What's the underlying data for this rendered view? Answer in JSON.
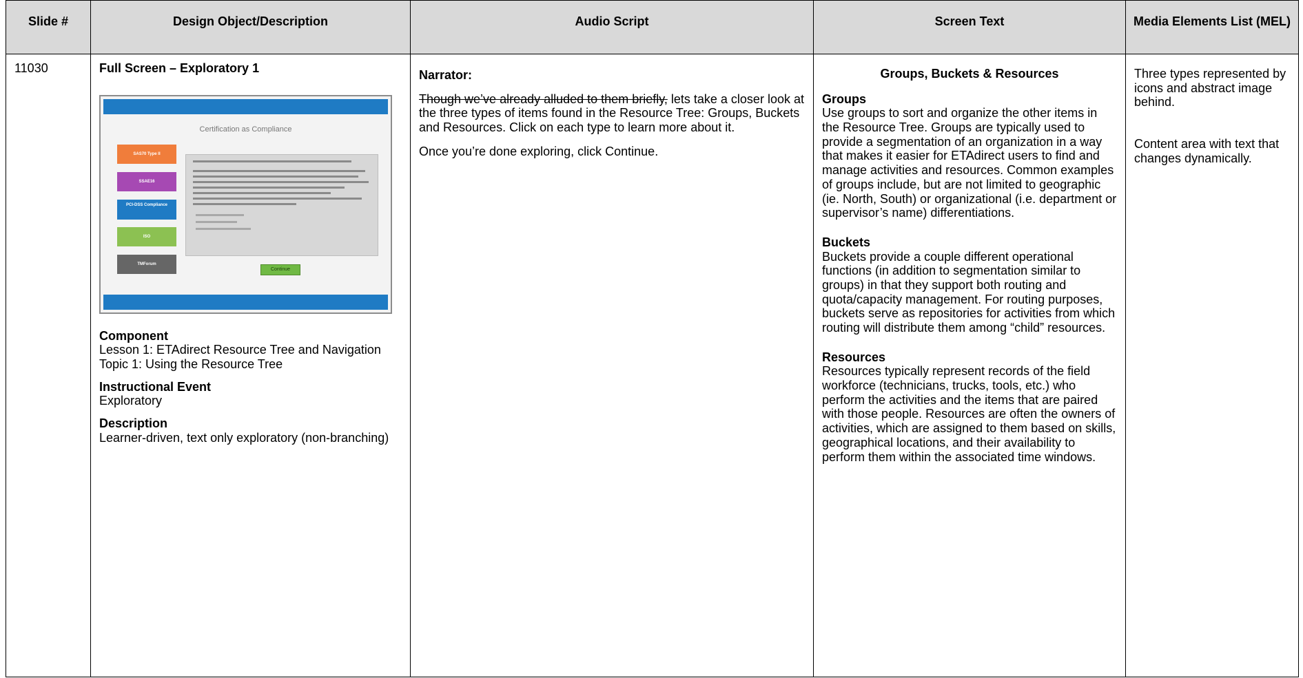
{
  "headers": {
    "slide": "Slide #",
    "design": "Design Object/Description",
    "audio": "Audio Script",
    "screen": "Screen Text",
    "mel": "Media Elements List (MEL)"
  },
  "row": {
    "slide_number": "11030",
    "design": {
      "title": "Full Screen – Exploratory 1",
      "thumbnail": {
        "title": "Certification as Compliance",
        "buttons": [
          {
            "label": "SAS70 Type II",
            "color": "#f07d3b"
          },
          {
            "label": "SSAE16",
            "color": "#a649b3"
          },
          {
            "label": "PCI-DSS Compliance",
            "color": "#1f7bc4"
          },
          {
            "label": "ISO",
            "color": "#8cc152"
          },
          {
            "label": "TMForum",
            "color": "#666666"
          }
        ],
        "continue_label": "Continue"
      },
      "component_heading": "Component",
      "component_line1": "Lesson 1: ETAdirect Resource Tree and Navigation",
      "component_line2": "Topic 1: Using the Resource Tree",
      "event_heading": "Instructional Event",
      "event_value": "Exploratory",
      "description_heading": "Description",
      "description_value": "Learner-driven, text only exploratory (non-branching)"
    },
    "audio": {
      "speaker": "Narrator:",
      "struck": "Though we’ve already alluded to them briefly,",
      "para1_rest": " lets take a closer look at the three types of items found in the Resource Tree: Groups, Buckets and Resources. Click on each type to learn more about it.",
      "para2": "Once you’re done exploring, click Continue."
    },
    "screen_text": {
      "title": "Groups, Buckets & Resources",
      "groups_heading": "Groups",
      "groups_body": "Use groups to sort and organize the other items in the Resource Tree. Groups are typically used to provide a segmentation of an organization in a way that makes it easier for ETAdirect users to find and manage activities and resources. Common examples of groups include, but are not limited to geographic (ie. North, South) or organizational (i.e. department or supervisor’s name) differentiations.",
      "buckets_heading": "Buckets",
      "buckets_body": "Buckets provide a couple different operational functions (in addition to segmentation similar to groups) in that they support both routing and quota/capacity management.  For routing purposes, buckets serve as repositories for activities from which routing will distribute them among “child” resources.",
      "resources_heading": "Resources",
      "resources_body": "Resources typically represent records of the field workforce (technicians, trucks, tools, etc.) who perform the activities and the items that are paired with those people. Resources are often the owners of activities, which are assigned to them based on skills, geographical locations, and their availability to perform them within the associated time windows."
    },
    "mel": {
      "item1": "Three types represented by icons and abstract image behind.",
      "item2": "Content area with text that changes dynamically."
    }
  }
}
